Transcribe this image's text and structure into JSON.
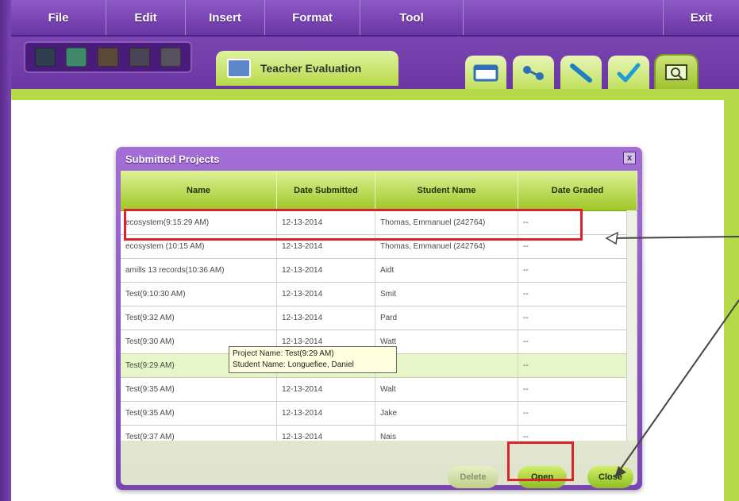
{
  "menu": {
    "file": "File",
    "edit": "Edit",
    "insert": "Insert",
    "format": "Format",
    "tool": "Tool",
    "exit": "Exit"
  },
  "tab": {
    "label": "Teacher Evaluation"
  },
  "dialog": {
    "title": "Submitted Projects",
    "close_glyph": "x",
    "columns": [
      "Name",
      "Date Submitted",
      "Student Name",
      "Date Graded"
    ],
    "rows": [
      {
        "name": "ecosystem(9:15:29 AM)",
        "date": "12-13-2014",
        "student": "Thomas, Emmanuel (242764)",
        "graded": "--"
      },
      {
        "name": "ecosystem (10:15 AM)",
        "date": "12-13-2014",
        "student": "Thomas, Emmanuel (242764)",
        "graded": "--"
      },
      {
        "name": "amills 13 records(10:36 AM)",
        "date": "12-13-2014",
        "student": "Aidt",
        "graded": "--"
      },
      {
        "name": "Test(9:10:30 AM)",
        "date": "12-13-2014",
        "student": "Smit",
        "graded": "--"
      },
      {
        "name": "Test(9:32 AM)",
        "date": "12-13-2014",
        "student": "Pard",
        "graded": "--"
      },
      {
        "name": "Test(9:30 AM)",
        "date": "12-13-2014",
        "student": "Watt",
        "graded": "--"
      },
      {
        "name": "Test(9:29 AM)",
        "date": "12-13-2014",
        "student": "",
        "graded": "--"
      },
      {
        "name": "Test(9:35 AM)",
        "date": "12-13-2014",
        "student": "Walt",
        "graded": "--"
      },
      {
        "name": "Test(9:35 AM)",
        "date": "12-13-2014",
        "student": "Jake",
        "graded": "--"
      },
      {
        "name": "Test(9:37 AM)",
        "date": "12-13-2014",
        "student": "Nais",
        "graded": "--"
      }
    ],
    "tooltip_line1": "Project Name: Test(9:29 AM)",
    "tooltip_line2": "Student Name: Longuefiee, Daniel",
    "buttons": {
      "delete": "Delete",
      "open": "Open",
      "close": "Close"
    }
  },
  "colors": {
    "menu_purple": "#7a45b0",
    "accent_green": "#b6d94a",
    "highlight_red": "#d9232d"
  }
}
